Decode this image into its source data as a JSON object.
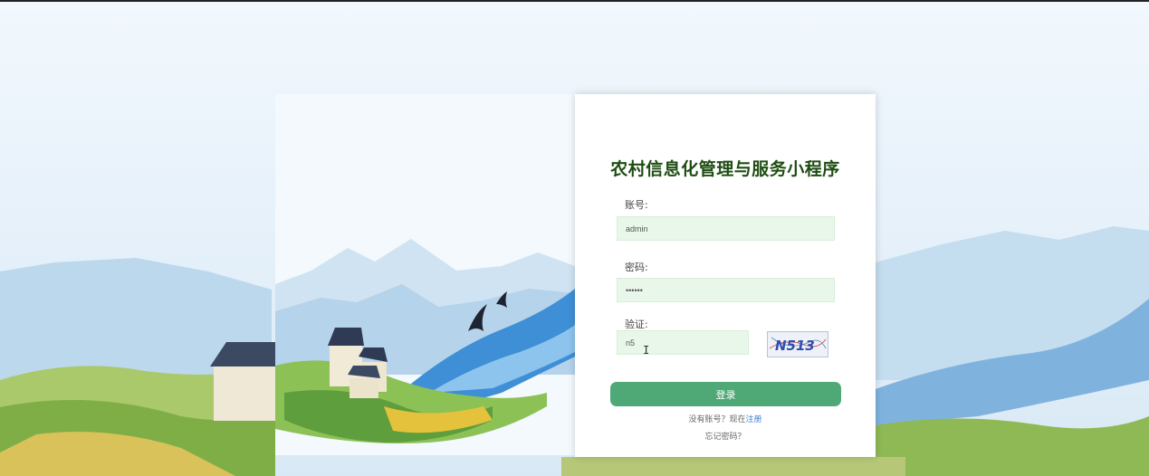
{
  "app": {
    "title": "农村信息化管理与服务小程序"
  },
  "form": {
    "account_label": "账号:",
    "account_value": "admin",
    "password_label": "密码:",
    "password_value": "••••••",
    "captcha_label": "验证:",
    "captcha_value": "n5",
    "captcha_text": "N513",
    "login_label": "登录",
    "register_prompt": "没有账号？现在",
    "register_link": "注册",
    "forgot_label": "忘记密码？"
  },
  "colors": {
    "title": "#1e4d12",
    "field_background": "#e8f7ea",
    "login_button": "#4fa976",
    "link": "#3b7fd9"
  }
}
